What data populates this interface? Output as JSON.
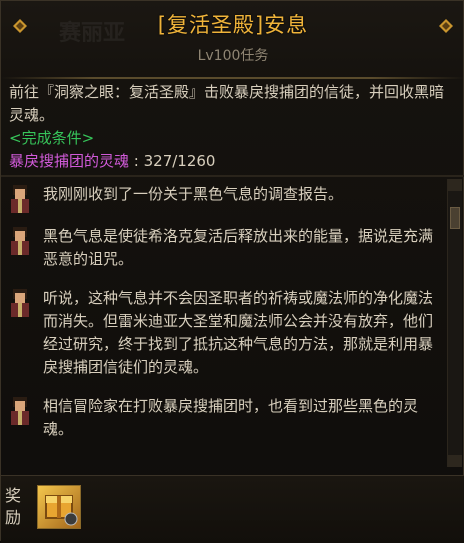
{
  "header": {
    "title": "[复活圣殿]安息",
    "subtitle": "Lv100任务",
    "background_text": "赛丽亚"
  },
  "description": {
    "text": "前往『洞察之眼：复活圣殿』击败暴戾搜捕团的信徒，并回收黑暗灵魂。",
    "condition_label": "<完成条件>",
    "condition_name": "暴戾搜捕团的灵魂",
    "condition_progress": "327/1260"
  },
  "dialogue": [
    {
      "text": "我刚刚收到了一份关于黑色气息的调查报告。"
    },
    {
      "text": "黑色气息是使徒希洛克复活后释放出来的能量，据说是充满恶意的诅咒。"
    },
    {
      "text": "听说，这种气息并不会因圣职者的祈祷或魔法师的净化魔法而消失。但雷米迪亚大圣堂和魔法师公会并没有放弃，他们经过研究，终于找到了抵抗这种气息的方法，那就是利用暴戾搜捕团信徒们的灵魂。"
    },
    {
      "text": "相信冒险家在打败暴戾搜捕团时，也看到过那些黑色的灵魂。"
    }
  ],
  "reward": {
    "label": "奖励",
    "item_icon": "golden-box-icon"
  },
  "colors": {
    "title": "#f0b43a",
    "condition_label": "#36c45a",
    "condition_name": "#d05ad8"
  }
}
